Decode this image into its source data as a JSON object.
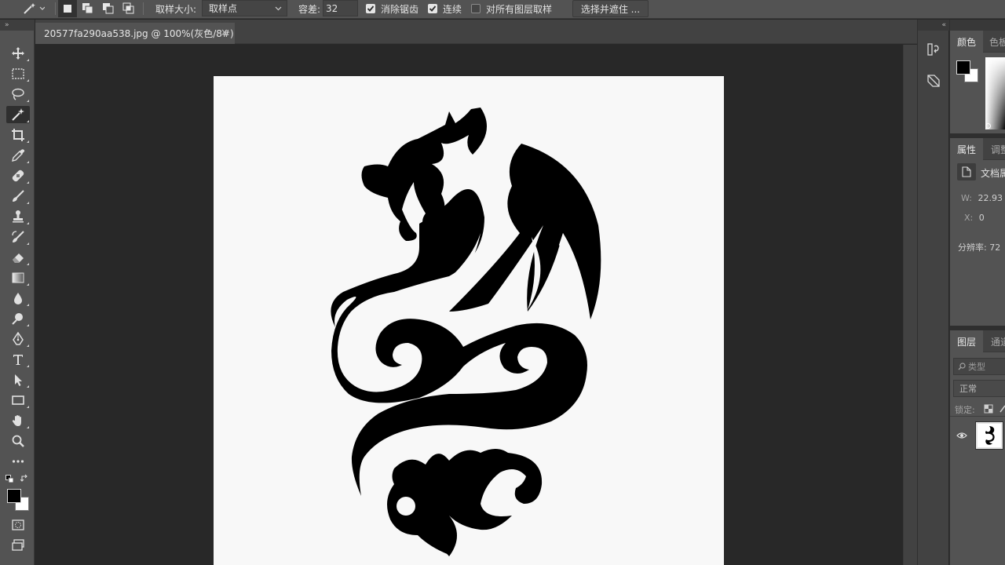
{
  "options_bar": {
    "sample_size_label": "取样大小:",
    "sample_size_value": "取样点",
    "tolerance_label": "容差:",
    "tolerance_value": "32",
    "anti_alias_label": "消除锯齿",
    "contiguous_label": "连续",
    "sample_all_layers_label": "对所有图层取样",
    "select_mask_button": "选择并遮住 ..."
  },
  "document": {
    "tab_title": "20577fa290aa538.jpg @ 100%(灰色/8#)",
    "close_glyph": "×"
  },
  "color_panel": {
    "tab_color": "颜色",
    "tab_swatches": "色板"
  },
  "properties_panel": {
    "tab_properties": "属性",
    "tab_adjustments": "调整",
    "doc_properties_label": "文档属",
    "w_label": "W:",
    "w_value": "22.93",
    "x_label": "X:",
    "x_value": "0",
    "resolution_label": "分辨率: 72"
  },
  "layers_panel": {
    "tab_layers": "图层",
    "tab_channels": "通道",
    "search_placeholder": "类型",
    "blend_mode": "正常",
    "lock_label": "锁定:"
  },
  "colors": {
    "foreground": "#000000",
    "background": "#ffffff",
    "canvas": "#f8f8f8"
  }
}
